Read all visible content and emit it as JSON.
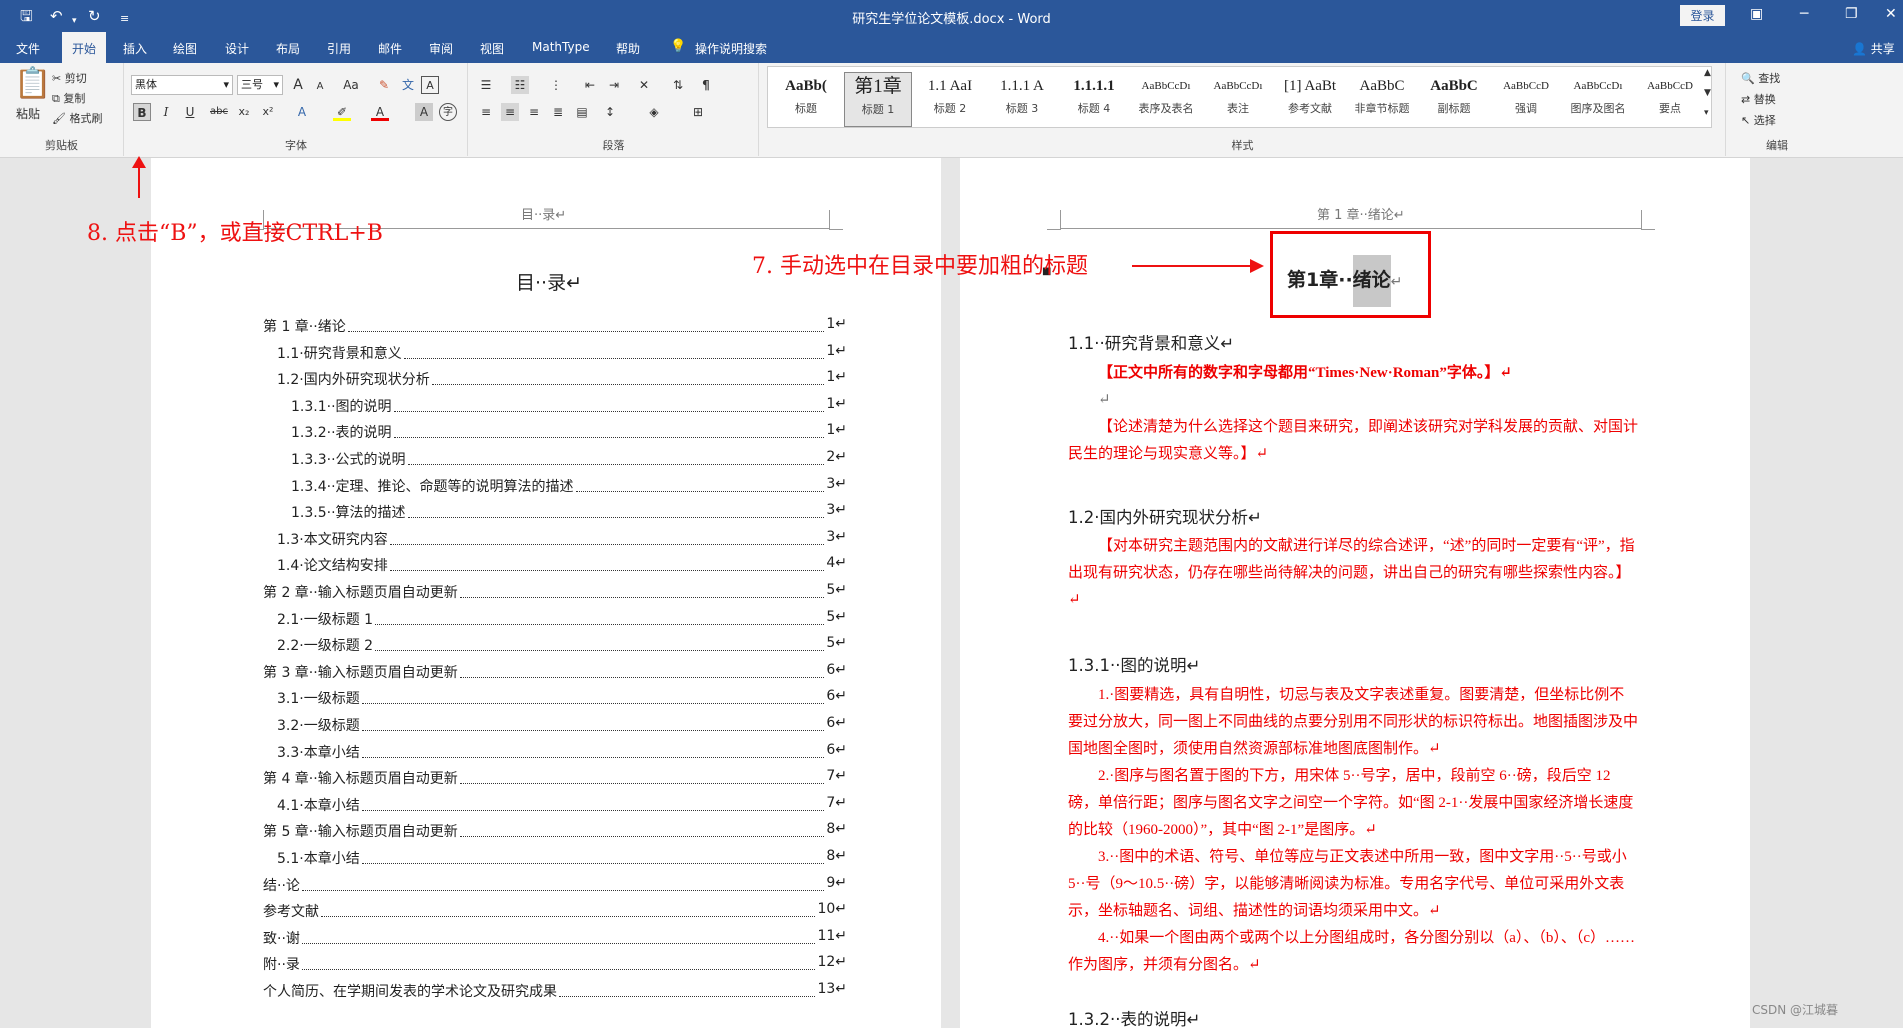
{
  "titlebar": {
    "doc_title": "研究生学位论文模板.docx  -  Word",
    "login": "登录",
    "share": "共享"
  },
  "quick_access": {
    "save_icon": "save-icon",
    "undo_icon": "undo-icon",
    "redo_icon": "redo-icon",
    "more_icon": "customize-icon"
  },
  "tabs": [
    "文件",
    "开始",
    "插入",
    "绘图",
    "设计",
    "布局",
    "引用",
    "邮件",
    "审阅",
    "视图",
    "MathType",
    "帮助",
    "操作说明搜索"
  ],
  "ribbon": {
    "clipboard": {
      "paste": "粘贴",
      "cut": "剪切",
      "copy": "复制",
      "format_painter": "格式刷",
      "label": "剪贴板"
    },
    "font": {
      "font_name": "黑体",
      "font_size": "三号",
      "label": "字体",
      "bold": "B",
      "italic": "I",
      "underline": "U",
      "strike": "abc",
      "sub": "x₂",
      "sup": "x²",
      "font_size_up": "A",
      "font_size_down": "A",
      "clear_format": "Aa"
    },
    "paragraph": {
      "label": "段落"
    },
    "styles": {
      "label": "样式",
      "items": [
        {
          "preview": "AaBb(",
          "name": "标题"
        },
        {
          "preview": "第1章",
          "name": "标题 1"
        },
        {
          "preview": "1.1  AaI",
          "name": "标题 2"
        },
        {
          "preview": "1.1.1  A",
          "name": "标题 3"
        },
        {
          "preview": "1.1.1.1",
          "name": "标题 4"
        },
        {
          "preview": "AaBbCcDı",
          "name": "表序及表名"
        },
        {
          "preview": "AaBbCcDı",
          "name": "表注"
        },
        {
          "preview": "[1] AaBt",
          "name": "参考文献"
        },
        {
          "preview": "AaBbC",
          "name": "非章节标题"
        },
        {
          "preview": "AaBbC",
          "name": "副标题"
        },
        {
          "preview": "AaBbCcD",
          "name": "强调"
        },
        {
          "preview": "AaBbCcDı",
          "name": "图序及图名"
        },
        {
          "preview": "AaBbCcD",
          "name": "要点"
        }
      ]
    },
    "editing": {
      "find": "查找",
      "replace": "替换",
      "select": "选择",
      "label": "编辑"
    }
  },
  "left_page": {
    "header": "目··录↵",
    "title": "目··录↵",
    "toc": [
      {
        "t": "第 1 章··绪论",
        "p": "1↵",
        "lvl": 0
      },
      {
        "t": "1.1·研究背景和意义",
        "p": "1↵",
        "lvl": 1
      },
      {
        "t": "1.2·国内外研究现状分析",
        "p": "1↵",
        "lvl": 1
      },
      {
        "t": "1.3.1··图的说明",
        "p": "1↵",
        "lvl": 2
      },
      {
        "t": "1.3.2··表的说明",
        "p": "1↵",
        "lvl": 2
      },
      {
        "t": "1.3.3··公式的说明",
        "p": "2↵",
        "lvl": 2
      },
      {
        "t": "1.3.4··定理、推论、命题等的说明算法的描述",
        "p": "3↵",
        "lvl": 2
      },
      {
        "t": "1.3.5··算法的描述",
        "p": "3↵",
        "lvl": 2
      },
      {
        "t": "1.3·本文研究内容",
        "p": "3↵",
        "lvl": 1
      },
      {
        "t": "1.4·论文结构安排",
        "p": "4↵",
        "lvl": 1
      },
      {
        "t": "第 2 章··输入标题页眉自动更新",
        "p": "5↵",
        "lvl": 0
      },
      {
        "t": "2.1·一级标题 1",
        "p": "5↵",
        "lvl": 1
      },
      {
        "t": "2.2·一级标题 2",
        "p": "5↵",
        "lvl": 1
      },
      {
        "t": "第 3 章··输入标题页眉自动更新",
        "p": "6↵",
        "lvl": 0
      },
      {
        "t": "3.1·一级标题",
        "p": "6↵",
        "lvl": 1
      },
      {
        "t": "3.2·一级标题",
        "p": "6↵",
        "lvl": 1
      },
      {
        "t": "3.3·本章小结",
        "p": "6↵",
        "lvl": 1
      },
      {
        "t": "第 4 章··输入标题页眉自动更新",
        "p": "7↵",
        "lvl": 0
      },
      {
        "t": "4.1·本章小结",
        "p": "7↵",
        "lvl": 1
      },
      {
        "t": "第 5 章··输入标题页眉自动更新",
        "p": "8↵",
        "lvl": 0
      },
      {
        "t": "5.1·本章小结",
        "p": "8↵",
        "lvl": 1
      },
      {
        "t": "结··论",
        "p": "9↵",
        "lvl": 0
      },
      {
        "t": "参考文献",
        "p": "10↵",
        "lvl": 0
      },
      {
        "t": "致··谢",
        "p": "11↵",
        "lvl": 0
      },
      {
        "t": "附··录",
        "p": "12↵",
        "lvl": 0
      },
      {
        "t": "个人简历、在学期间发表的学术论文及研究成果",
        "p": "13↵",
        "lvl": 0
      }
    ]
  },
  "right_page": {
    "header": "第 1 章··绪论↵",
    "chapter_title_a": "第1章··",
    "chapter_title_b": "绪论",
    "chapter_end": "↵",
    "h11": "1.1··研究背景和意义↵",
    "p1": "【正文中所有的数字和字母都用“Times·New·Roman”字体。】↵",
    "p1b": "↵",
    "p2": "【论述清楚为什么选择这个题目来研究，即阐述该研究对学科发展的贡献、对国计民生的理论与现实意义等。】↵",
    "h12": "1.2·国内外研究现状分析↵",
    "p3": "【对本研究主题范围内的文献进行详尽的综合述评，“述”的同时一定要有“评”，指出现有研究状态，仍存在哪些尚待解决的问题，讲出自己的研究有哪些探索性内容。】↵",
    "h131": "1.3.1··图的说明↵",
    "p4": "1.·图要精选，具有自明性，切忌与表及文字表述重复。图要清楚，但坐标比例不要过分放大，同一图上不同曲线的点要分别用不同形状的标识符标出。地图插图涉及中国地图全图时，须使用自然资源部标准地图底图制作。↵",
    "p5": "2.·图序与图名置于图的下方，用宋体 5··号字，居中，段前空 6··磅，段后空 12 磅，单倍行距；图序与图名文字之间空一个字符。如“图 2-1··发展中国家经济增长速度的比较（1960-2000）”，其中“图 2-1”是图序。↵",
    "p6": "3.··图中的术语、符号、单位等应与正文表述中所用一致，图中文字用··5··号或小 5··号（9～10.5··磅）字，以能够清晰阅读为标准。专用名字代号、单位可采用外文表示，坐标轴题名、词组、描述性的词语均须采用中文。↵",
    "p7": "4.··如果一个图由两个或两个以上分图组成时，各分图分别以（a）、（b）、（c）……作为图序，并须有分图名。↵",
    "h132": "1.3.2··表的说明↵"
  },
  "annotations": {
    "step8": "8. 点击“B”，或直接CTRL+B",
    "step7": "7. 手动选中在目录中要加粗的标题"
  },
  "watermark": "CSDN @江城暮"
}
